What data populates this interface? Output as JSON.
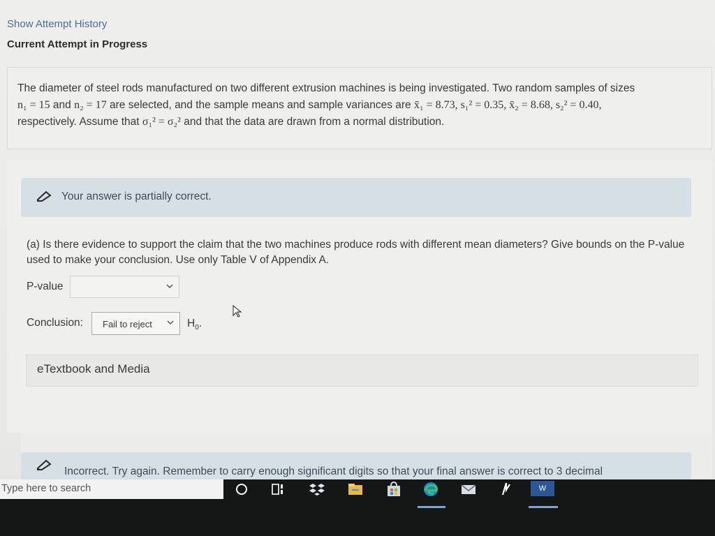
{
  "header": {
    "show_history_link": "Show Attempt History",
    "current_attempt_label": "Current Attempt in Progress"
  },
  "question": {
    "line1": "The diameter of steel rods manufactured on two different extrusion machines is being investigated. Two random samples of sizes",
    "n1": "n₁ = 15",
    "and1": " and ",
    "n2": "n₂ = 17",
    "line2_mid": " are selected, and the sample means and sample variances are ",
    "stats": "x̄₁ = 8.73, s₁² = 0.35, x̄₂ = 8.68, s₂² = 0.40,",
    "line3_a": "respectively. Assume that ",
    "sigma_eq": "σ₁² = σ₂²",
    "line3_b": " and that the data are drawn from a normal distribution."
  },
  "feedback_partial": {
    "icon": "pencil-icon",
    "message": "Your answer is partially correct."
  },
  "part_a": {
    "question": "(a) Is there evidence to support the claim that the two machines produce rods with different mean diameters? Give bounds on the P-value used to make your conclusion. Use only Table V of Appendix A.",
    "pvalue_label": "P-value",
    "pvalue_selected": "",
    "conclusion_label": "Conclusion:",
    "conclusion_selected": "Fail to reject",
    "h0_label": "H",
    "h0_sub": "0",
    "h0_period": "."
  },
  "etextbook": {
    "label": "eTextbook and Media"
  },
  "feedback_incorrect": {
    "icon": "pencil-icon",
    "message": "Incorrect. Try again. Remember to carry enough significant digits so that your final answer is correct to 3 decimal"
  },
  "taskbar": {
    "search_placeholder": "Type here to search",
    "icons": [
      "cortana-icon",
      "task-view-icon",
      "dropbox-icon",
      "file-explorer-icon",
      "store-icon",
      "edge-icon",
      "mail-icon",
      "app-icon",
      "word-icon"
    ],
    "word_label": "W"
  }
}
